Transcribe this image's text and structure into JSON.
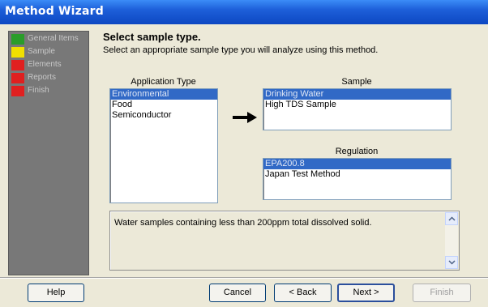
{
  "window": {
    "title": "Method Wizard"
  },
  "sidebar": {
    "steps": [
      {
        "label": "General Items",
        "color": "#2a9d2a"
      },
      {
        "label": "Sample",
        "color": "#f0e000"
      },
      {
        "label": "Elements",
        "color": "#e02020"
      },
      {
        "label": "Reports",
        "color": "#e02020"
      },
      {
        "label": "Finish",
        "color": "#e02020"
      }
    ]
  },
  "page": {
    "heading": "Select sample type.",
    "subheading": "Select an appropriate sample type you will analyze using this method."
  },
  "application_type": {
    "label": "Application Type",
    "items": [
      "Environmental",
      "Food",
      "Semiconductor"
    ],
    "selected": "Environmental"
  },
  "sample": {
    "label": "Sample",
    "items": [
      "Drinking Water",
      "High TDS Sample"
    ],
    "selected": "Drinking Water"
  },
  "regulation": {
    "label": "Regulation",
    "items": [
      "EPA200.8",
      "Japan Test Method"
    ],
    "selected": "EPA200.8"
  },
  "description": {
    "text": "Water samples containing less than 200ppm total dissolved solid."
  },
  "buttons": {
    "help": "Help",
    "cancel": "Cancel",
    "back": "< Back",
    "next": "Next >",
    "finish": "Finish"
  }
}
